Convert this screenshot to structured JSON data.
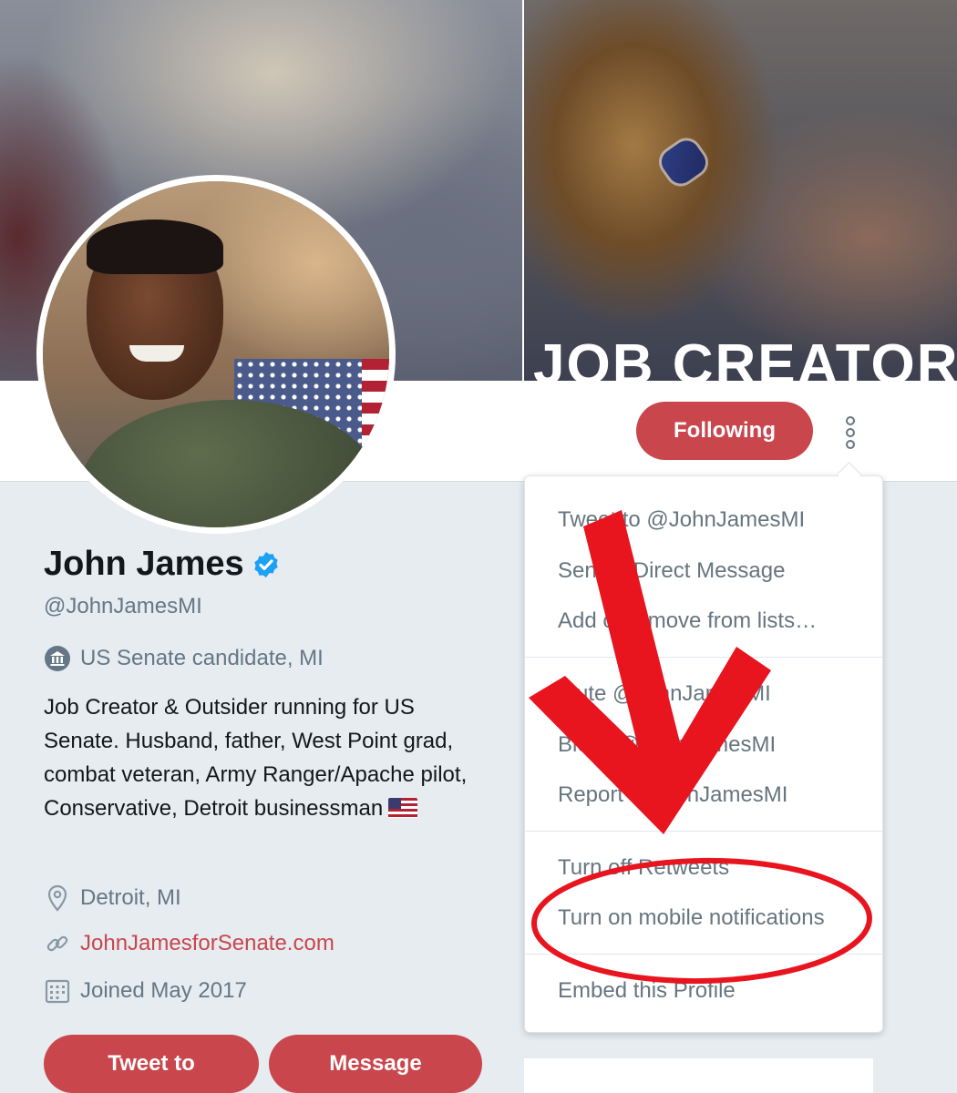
{
  "banner": {
    "slogan": "JOB CREATOR"
  },
  "profile": {
    "name": "John James",
    "handle": "@JohnJamesMI",
    "title_line": "US Senate candidate, MI",
    "bio": "Job Creator & Outsider running for US Senate. Husband, father, West Point grad, combat veteran, Army Ranger/Apache pilot, Conservative, Detroit businessman",
    "location": "Detroit, MI",
    "website": "JohnJamesforSenate.com",
    "joined": "Joined May 2017"
  },
  "actions": {
    "following_label": "Following",
    "tweet_to_label": "Tweet to",
    "message_label": "Message"
  },
  "menu": {
    "items": [
      "Tweet to @JohnJamesMI",
      "Send a Direct Message",
      "Add or remove from lists…",
      "Mute @JohnJamesMI",
      "Block @JohnJamesMI",
      "Report @JohnJamesMI",
      "Turn off Retweets",
      "Turn on mobile notifications",
      "Embed this Profile"
    ]
  },
  "icons": {
    "verified": "verified-badge-icon",
    "title": "government-building-icon",
    "location": "location-pin-icon",
    "website": "link-icon",
    "joined": "calendar-icon",
    "more": "more-vertical-icon"
  },
  "colors": {
    "accent": "#c9464c",
    "verified": "#1da1f2",
    "annotation": "#e8141e"
  }
}
